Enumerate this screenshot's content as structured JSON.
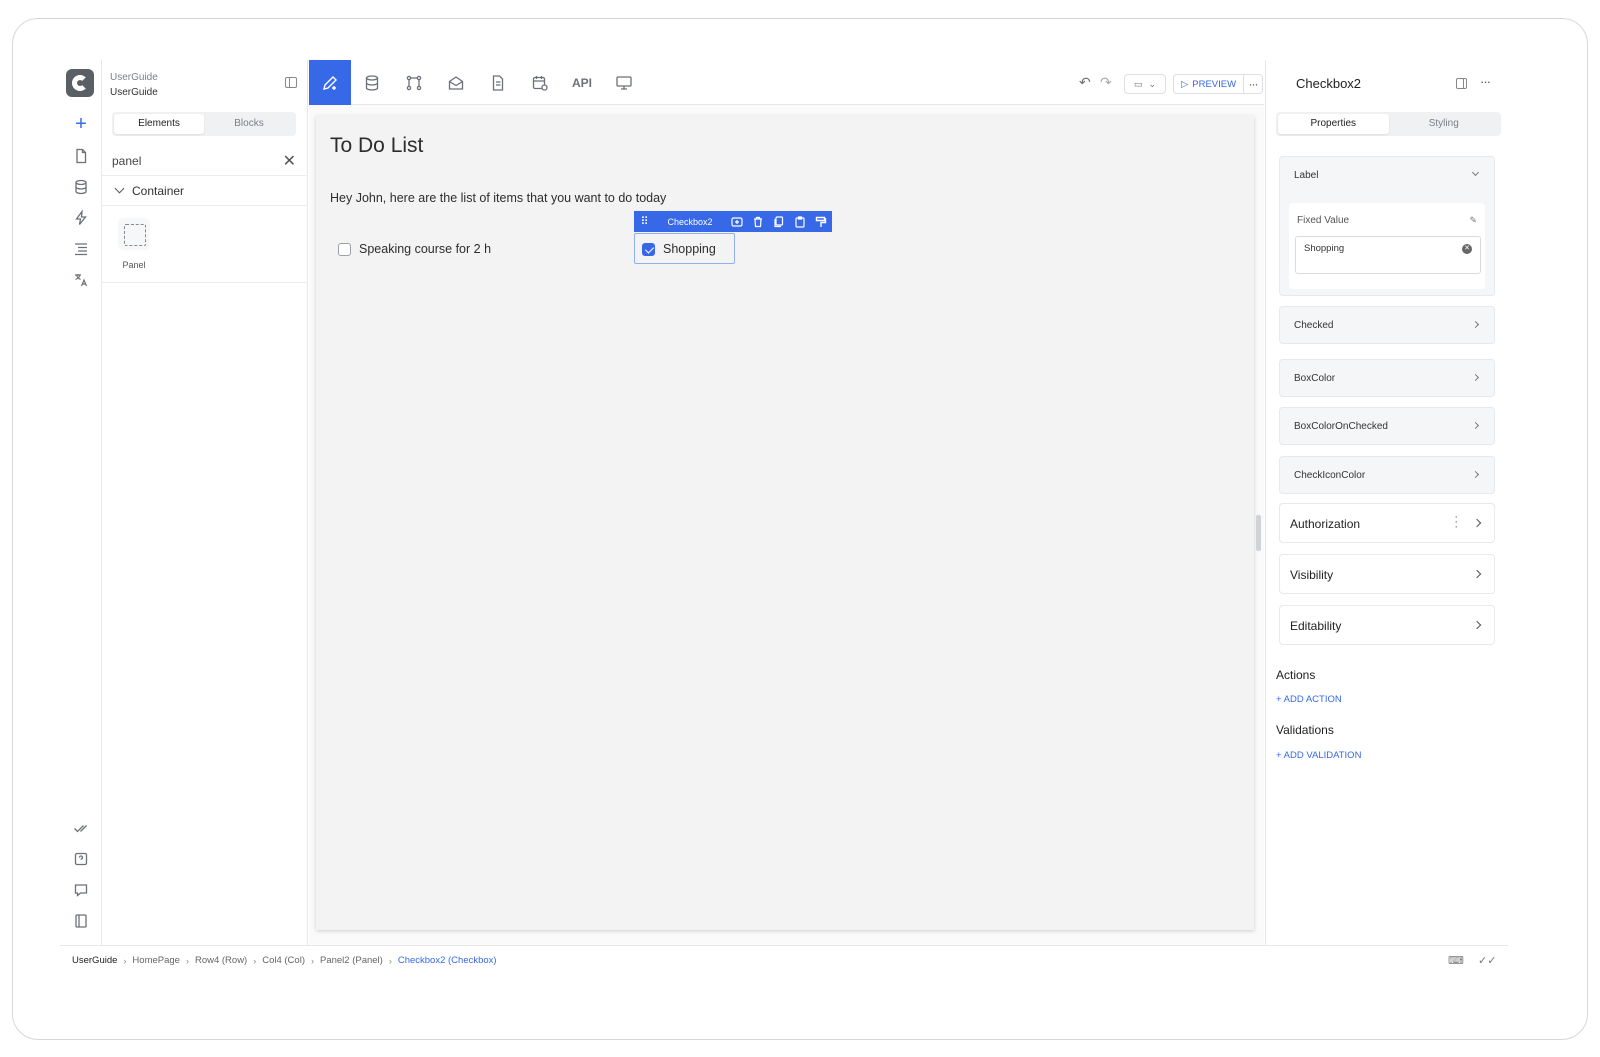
{
  "project": {
    "line1": "UserGuide",
    "line2": "UserGuide"
  },
  "left_panel": {
    "tabs": [
      "Elements",
      "Blocks"
    ],
    "search_value": "panel",
    "group_label": "Container",
    "tile_label": "Panel"
  },
  "toolbar": {
    "api_label": "API",
    "preview_label": "PREVIEW",
    "more_label": "···"
  },
  "canvas": {
    "title": "To Do List",
    "subtitle": "Hey John, here are the list of items that you want to do today",
    "checkbox1_label": "Speaking course for 2 h",
    "checkbox2_label": "Shopping",
    "selected_name": "Checkbox2"
  },
  "right_panel": {
    "title": "Checkbox2",
    "tabs": [
      "Properties",
      "Styling"
    ],
    "label_section": "Label",
    "fixed_value_label": "Fixed Value",
    "fixed_value": "Shopping",
    "sections": [
      "Checked",
      "BoxColor",
      "BoxColorOnChecked",
      "CheckIconColor"
    ],
    "sections2": [
      "Authorization",
      "Visibility",
      "Editability"
    ],
    "actions_heading": "Actions",
    "add_action": "+ ADD ACTION",
    "validations_heading": "Validations",
    "add_validation": "+ ADD VALIDATION"
  },
  "breadcrumb": [
    "UserGuide",
    "HomePage",
    "Row4 (Row)",
    "Col4 (Col)",
    "Panel2 (Panel)",
    "Checkbox2 (Checkbox)"
  ],
  "colors": {
    "accent": "#3668e8"
  }
}
